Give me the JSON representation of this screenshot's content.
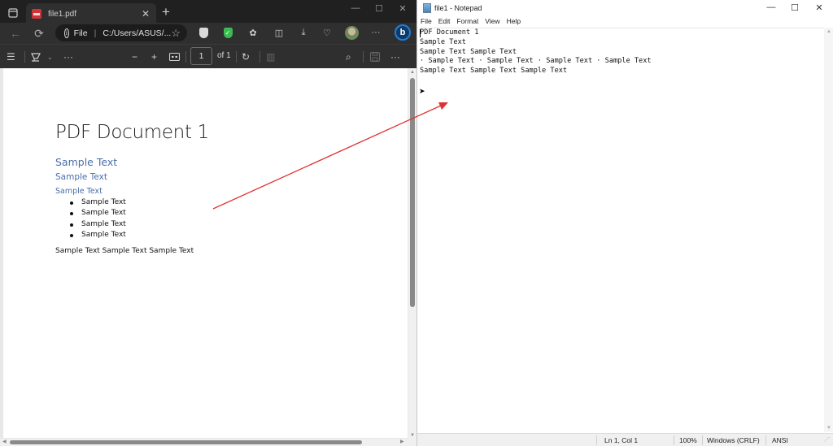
{
  "edge": {
    "tab": {
      "title": "file1.pdf",
      "close_icon": "close-icon"
    },
    "address": {
      "scheme_label": "File",
      "url": "C:/Users/ASUS/..."
    },
    "pdf_toolbar": {
      "page_current": "1",
      "page_total_label": "of 1"
    },
    "pdf": {
      "title": "PDF Document 1",
      "heading1": "Sample Text",
      "heading2": "Sample Text",
      "heading3": "Sample Text",
      "bullets": [
        "Sample Text",
        "Sample Text",
        "Sample Text",
        "Sample Text"
      ],
      "paragraph": "Sample Text Sample Text Sample Text"
    }
  },
  "notepad": {
    "title": "file1 - Notepad",
    "menu": [
      "File",
      "Edit",
      "Format",
      "View",
      "Help"
    ],
    "content": "PDF Document 1\nSample Text\nSample Text Sample Text\n· Sample Text · Sample Text · Sample Text · Sample Text\nSample Text Sample Text Sample Text",
    "status": {
      "position": "Ln 1, Col 1",
      "zoom": "100%",
      "line_ending": "Windows (CRLF)",
      "encoding": "ANSI"
    }
  },
  "annotation": {
    "arrow_color": "#e03030"
  }
}
